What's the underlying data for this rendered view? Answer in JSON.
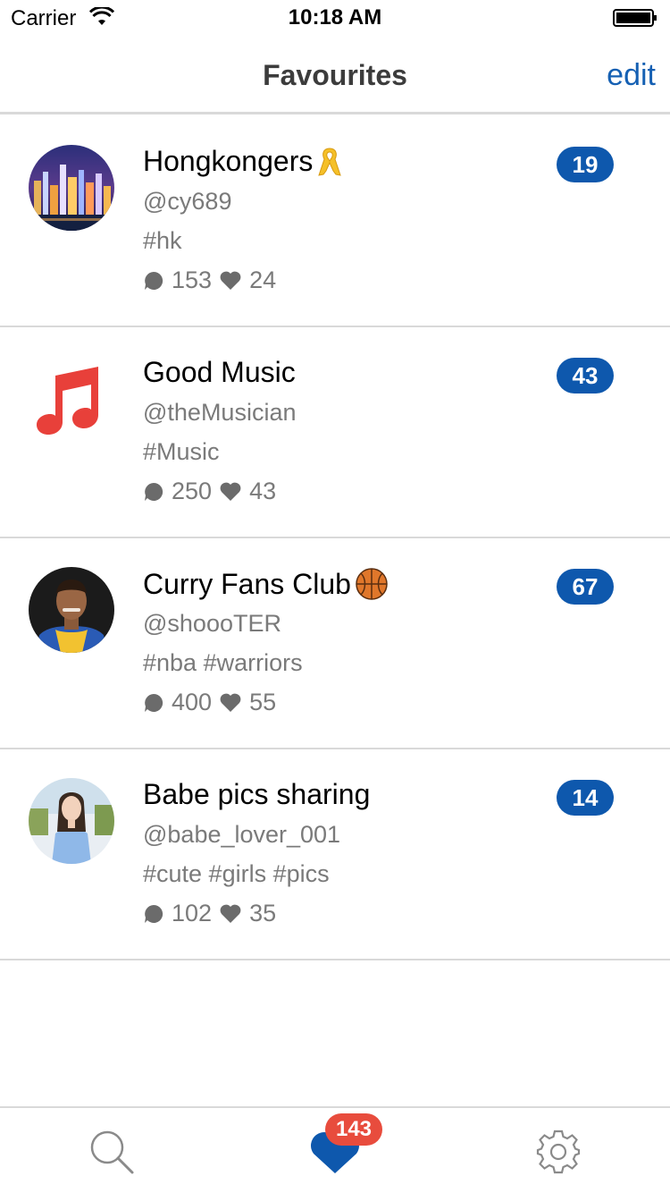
{
  "status_bar": {
    "carrier": "Carrier",
    "time": "10:18 AM"
  },
  "nav": {
    "title": "Favourites",
    "edit_label": "edit"
  },
  "items": [
    {
      "title": "Hongkongers",
      "emoji": "ribbon-icon",
      "handle": "@cy689",
      "tags": "#hk",
      "comments": "153",
      "likes": "24",
      "count": "19",
      "avatar": "city-night-photo"
    },
    {
      "title": "Good Music",
      "emoji": "",
      "handle": "@theMusician",
      "tags": "#Music",
      "comments": "250",
      "likes": "43",
      "count": "43",
      "avatar": "music-note-icon"
    },
    {
      "title": "Curry Fans Club",
      "emoji": "basketball-icon",
      "handle": "@shoooTER",
      "tags": "#nba #warriors",
      "comments": "400",
      "likes": "55",
      "count": "67",
      "avatar": "player-photo"
    },
    {
      "title": "Babe pics sharing",
      "emoji": "",
      "handle": "@babe_lover_001",
      "tags": "#cute #girls #pics",
      "comments": "102",
      "likes": "35",
      "count": "14",
      "avatar": "person-photo"
    }
  ],
  "tab_bar": {
    "tabs": [
      "search-icon",
      "heart-icon",
      "gear-icon"
    ],
    "favourites_badge": "143"
  },
  "colors": {
    "accent": "#0e58ad",
    "badge_red": "#e84c3d",
    "music_red": "#e8403a",
    "ribbon_yellow": "#f5c028"
  }
}
